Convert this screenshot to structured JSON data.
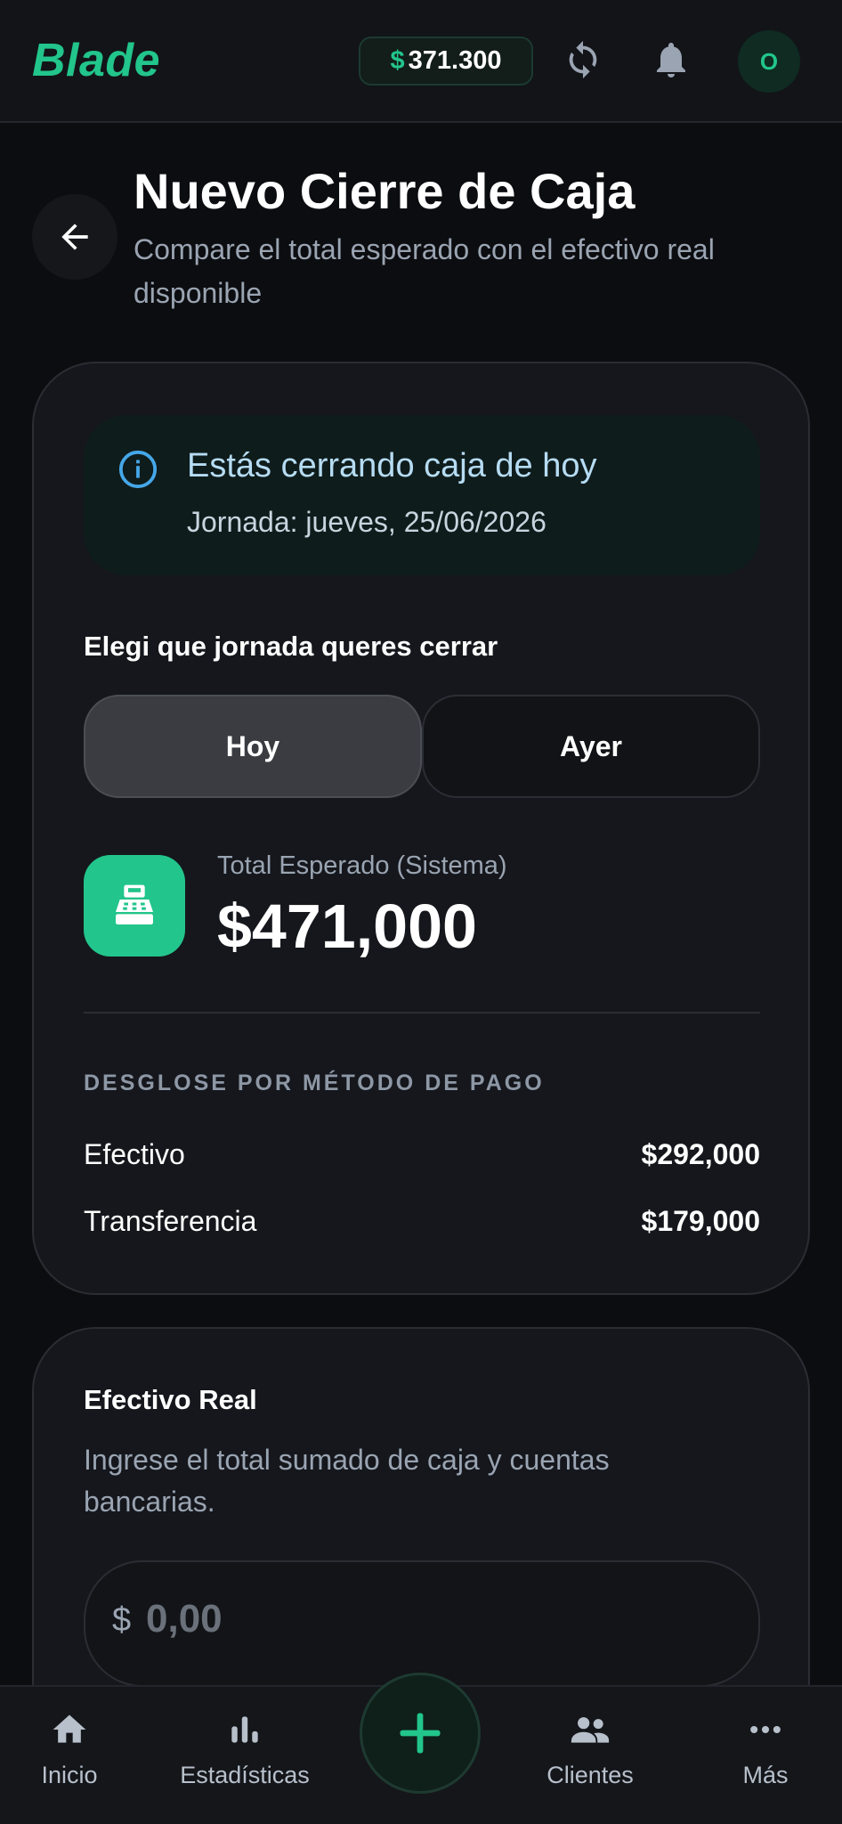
{
  "topbar": {
    "logo": "Blade",
    "balance_currency": "$",
    "balance": "371.300",
    "avatar_initial": "O",
    "accent": "#22c58b"
  },
  "header": {
    "title": "Nuevo Cierre de Caja",
    "subtitle": "Compare el total esperado con el efectivo real disponible"
  },
  "info": {
    "title": "Estás cerrando caja de hoy",
    "subtitle": "Jornada: jueves, 25/06/2026"
  },
  "day_picker": {
    "label": "Elegi que jornada queres cerrar",
    "options": [
      "Hoy",
      "Ayer"
    ],
    "selected": "Hoy"
  },
  "expected": {
    "label": "Total Esperado (Sistema)",
    "value": "$471,000"
  },
  "breakdown": {
    "title": "DESGLOSE POR MÉTODO DE PAGO",
    "rows": [
      {
        "label": "Efectivo",
        "value": "$292,000"
      },
      {
        "label": "Transferencia",
        "value": "$179,000"
      }
    ]
  },
  "real_cash": {
    "title": "Efectivo Real",
    "description": "Ingrese el total sumado de caja y cuentas bancarias.",
    "currency": "$",
    "placeholder": "0,00",
    "value": ""
  },
  "bottom_nav": {
    "items": [
      {
        "label": "Inicio",
        "icon": "home-icon"
      },
      {
        "label": "Estadísticas",
        "icon": "bar-chart-icon"
      },
      {
        "label": "Clientes",
        "icon": "people-icon"
      },
      {
        "label": "Más",
        "icon": "more-icon"
      }
    ],
    "fab_icon": "plus-icon"
  }
}
